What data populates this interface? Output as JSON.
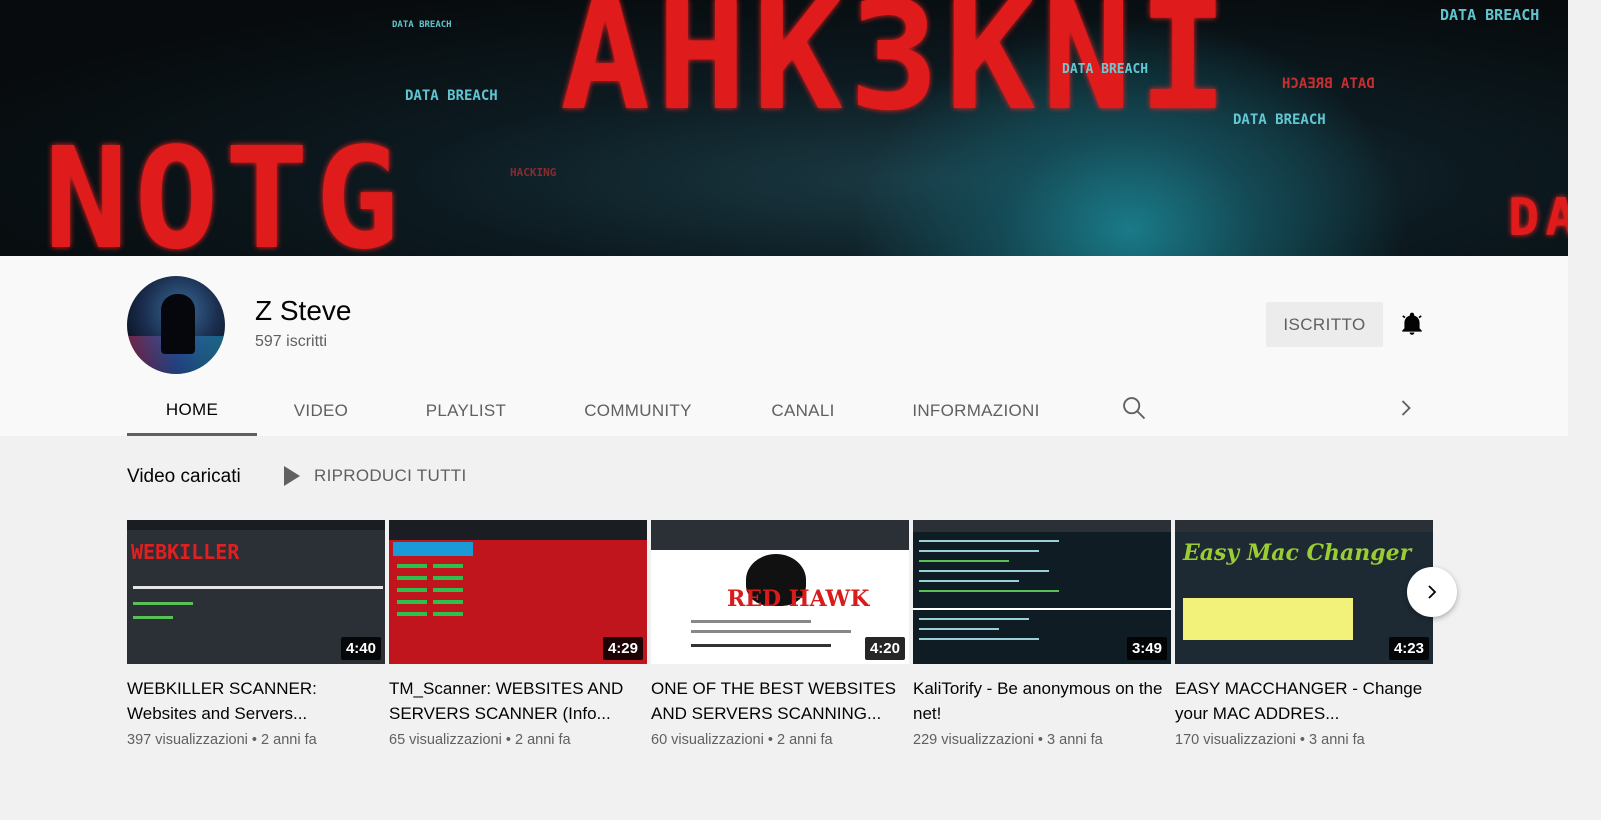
{
  "banner": {
    "big_text": "AHK3KNI",
    "left_text": "NOTG",
    "right_text": "DA",
    "tags": [
      "DATA BREACH",
      "DATA BREACH",
      "DATA BREACH",
      "DATA BREACH",
      "DATA BREACH",
      "HACKING"
    ],
    "mirror_tag": "DATA BREACH"
  },
  "channel": {
    "name": "Z Steve",
    "subscribers": "597 iscritti",
    "subscribe_label": "ISCRITTO"
  },
  "tabs": [
    "HOME",
    "VIDEO",
    "PLAYLIST",
    "COMMUNITY",
    "CANALI",
    "INFORMAZIONI"
  ],
  "active_tab": "HOME",
  "section": {
    "title": "Video caricati",
    "play_all": "RIPRODUCI TUTTI"
  },
  "videos": [
    {
      "title": "WEBKILLER SCANNER: Websites and Servers...",
      "duration": "4:40",
      "views": "397 visualizzazioni",
      "age": "2 anni fa",
      "thumb_text": "WEBKILLER"
    },
    {
      "title": "TM_Scanner: WEBSITES AND SERVERS SCANNER (Info...",
      "duration": "4:29",
      "views": "65 visualizzazioni",
      "age": "2 anni fa",
      "thumb_text": ""
    },
    {
      "title": "ONE OF THE BEST WEBSITES AND SERVERS SCANNING...",
      "duration": "4:20",
      "views": "60 visualizzazioni",
      "age": "2 anni fa",
      "thumb_text": "RED HAWK"
    },
    {
      "title": "KaliTorify - Be anonymous on the net!",
      "duration": "3:49",
      "views": "229 visualizzazioni",
      "age": "3 anni fa",
      "thumb_text": ""
    },
    {
      "title": "EASY MACCHANGER - Change your MAC ADDRES...",
      "duration": "4:23",
      "views": "170 visualizzazioni",
      "age": "3 anni fa",
      "thumb_text": "Easy Mac Changer"
    }
  ],
  "meta_separator": " • ",
  "colors": {
    "banner_red": "#e01b1b",
    "banner_cyan": "#6ad8e4",
    "header_bg": "#f9f9f9",
    "page_bg": "#f1f1f1",
    "muted_text": "#606060"
  },
  "icons": {
    "bell": "bell-icon",
    "search": "search-icon",
    "tabs_next": "chevron-right-icon",
    "play": "play-icon",
    "carousel_next": "chevron-right-icon"
  }
}
